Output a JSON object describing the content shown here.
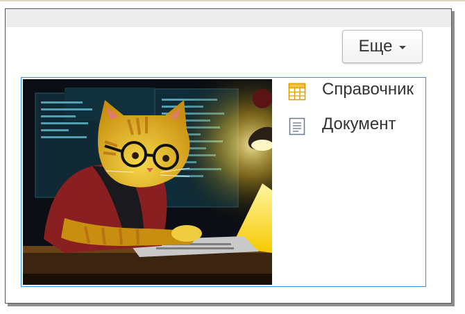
{
  "toolbar": {
    "more_label": "Еще"
  },
  "menu": {
    "items": [
      {
        "label": "Справочник",
        "icon": "catalog-table-icon"
      },
      {
        "label": "Документ",
        "icon": "document-icon"
      }
    ]
  },
  "picture": {
    "subject": "yellow-cat-with-glasses-at-laptop"
  },
  "colors": {
    "selection_border": "#3d8fe0",
    "catalog_icon": "#e0a000",
    "document_icon": "#6e7f91"
  }
}
